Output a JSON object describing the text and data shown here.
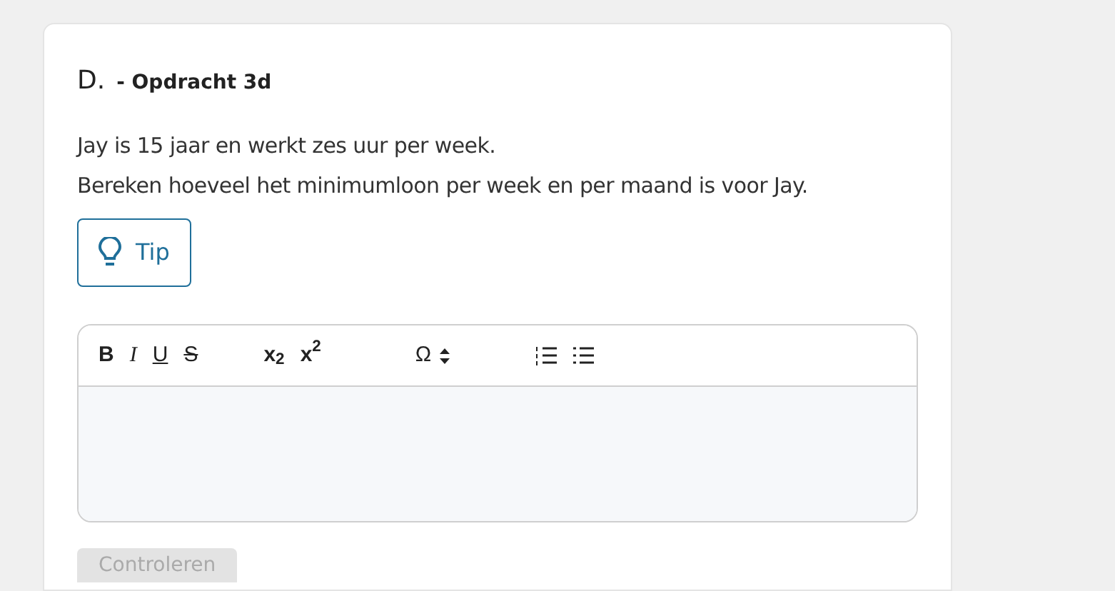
{
  "question": {
    "letter": "D.",
    "title": "- Opdracht 3d"
  },
  "paragraphs": [
    "Jay is 15 jaar en werkt zes uur per week.",
    "Bereken hoeveel het minimumloon per week en per maand is voor Jay."
  ],
  "tip_button": {
    "label": "Tip"
  },
  "editor": {
    "toolbar": [
      [
        {
          "kind": "bold",
          "label": "B"
        },
        {
          "kind": "italic",
          "label": "I"
        },
        {
          "kind": "underline",
          "label": "U"
        },
        {
          "kind": "strike",
          "label": "S"
        }
      ],
      [
        {
          "kind": "script",
          "label": "x$_{2}$"
        },
        {
          "kind": "script",
          "label": "x$^{2}$"
        }
      ],
      [
        {
          "kind": "special",
          "label": "Ω"
        }
      ],
      [
        {
          "kind": "ordered-list"
        },
        {
          "kind": "bullet-list"
        }
      ]
    ]
  },
  "submit_button": {
    "label": "Controleren",
    "disabled": true
  }
}
